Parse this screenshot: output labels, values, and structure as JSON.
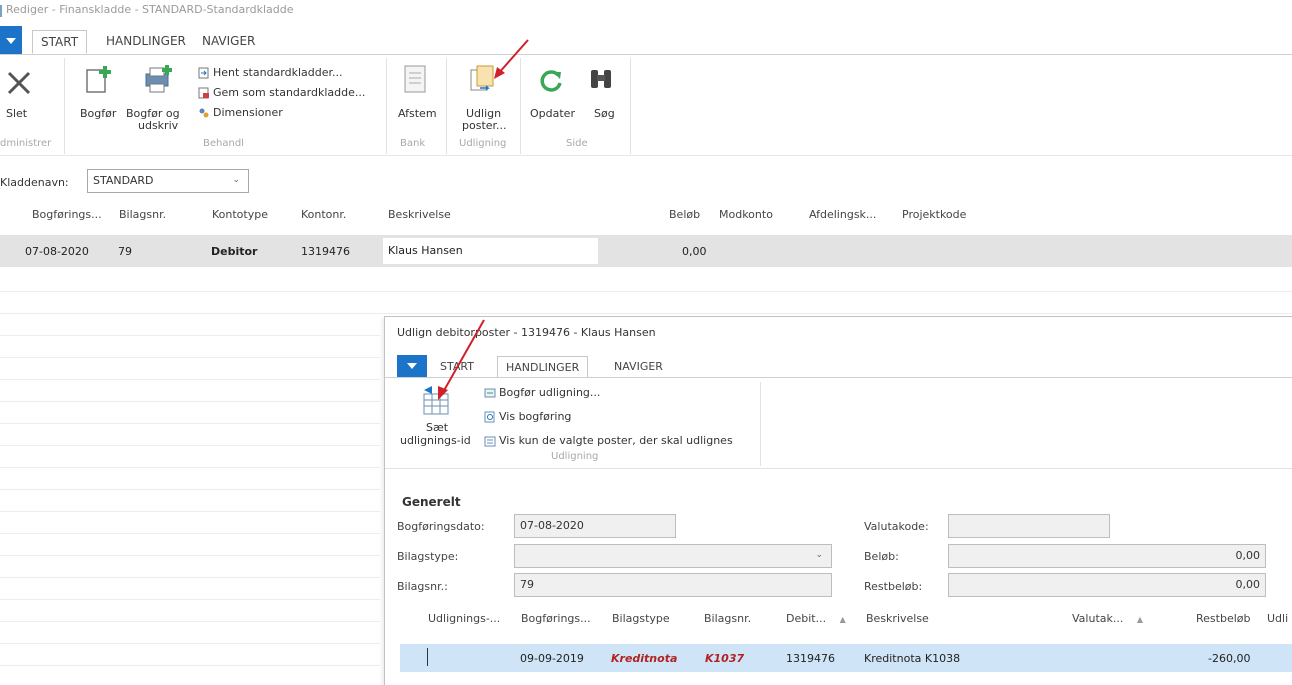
{
  "window": {
    "title": "Rediger - Finanskladde - STANDARD-Standardkladde",
    "tabs": [
      "START",
      "HANDLINGER",
      "NAVIGER"
    ]
  },
  "ribbon": {
    "delete": "Slet",
    "post": "Bogfør",
    "post_print_line1": "Bogfør og",
    "post_print_line2": "udskriv",
    "get_standard": "Hent standardkladder...",
    "save_standard": "Gem som standardkladde...",
    "dimensions": "Dimensioner",
    "reconcile": "Afstem",
    "apply_line1": "Udlign",
    "apply_line2": "poster...",
    "refresh": "Opdater",
    "find": "Søg",
    "groups": {
      "manage": "dministrer",
      "process": "Behandl",
      "bank": "Bank",
      "application": "Udligning",
      "page": "Side"
    }
  },
  "journal": {
    "label": "Kladdenavn:",
    "value": "STANDARD"
  },
  "columns": [
    "Bogførings...",
    "Bilagsnr.",
    "Kontotype",
    "Kontonr.",
    "Beskrivelse",
    "Beløb",
    "Modkonto",
    "Afdelingsk...",
    "Projektkode"
  ],
  "row": {
    "date": "07-08-2020",
    "doc_no": "79",
    "account_type": "Debitor",
    "account_no": "1319476",
    "description": "Klaus Hansen",
    "amount": "0,00"
  },
  "dialog": {
    "title": "Udlign debitorposter - 1319476 - Klaus Hansen",
    "tabs": [
      "START",
      "HANDLINGER",
      "NAVIGER"
    ],
    "set_id_line1": "Sæt",
    "set_id_line2": "udlignings-id",
    "post_application": "Bogfør udligning...",
    "preview_posting": "Vis bogføring",
    "show_only": "Vis kun de valgte poster, der skal udlignes",
    "group_label": "Udligning",
    "general": {
      "heading": "Generelt",
      "posting_date_label": "Bogføringsdato:",
      "posting_date": "07-08-2020",
      "doc_type_label": "Bilagstype:",
      "doc_type": "",
      "doc_no_label": "Bilagsnr.:",
      "doc_no": "79",
      "currency_label": "Valutakode:",
      "currency": "",
      "amount_label": "Beløb:",
      "amount": "0,00",
      "remaining_label": "Restbeløb:",
      "remaining": "0,00"
    },
    "grid_columns": [
      "Udlignings-...",
      "Bogførings...",
      "Bilagstype",
      "Bilagsnr.",
      "Debit...",
      "Beskrivelse",
      "Valutak...",
      "Restbeløb",
      "Udli"
    ],
    "entry": {
      "date": "09-09-2019",
      "doc_type": "Kreditnota",
      "doc_no": "K1037",
      "customer": "1319476",
      "description": "Kreditnota K1038",
      "remaining": "-260,00"
    }
  },
  "colors": {
    "accent": "#1b74c8",
    "selected_row": "#cfe5f7",
    "highlight_red": "#b22222",
    "annotation_arrow": "#d0202a"
  }
}
